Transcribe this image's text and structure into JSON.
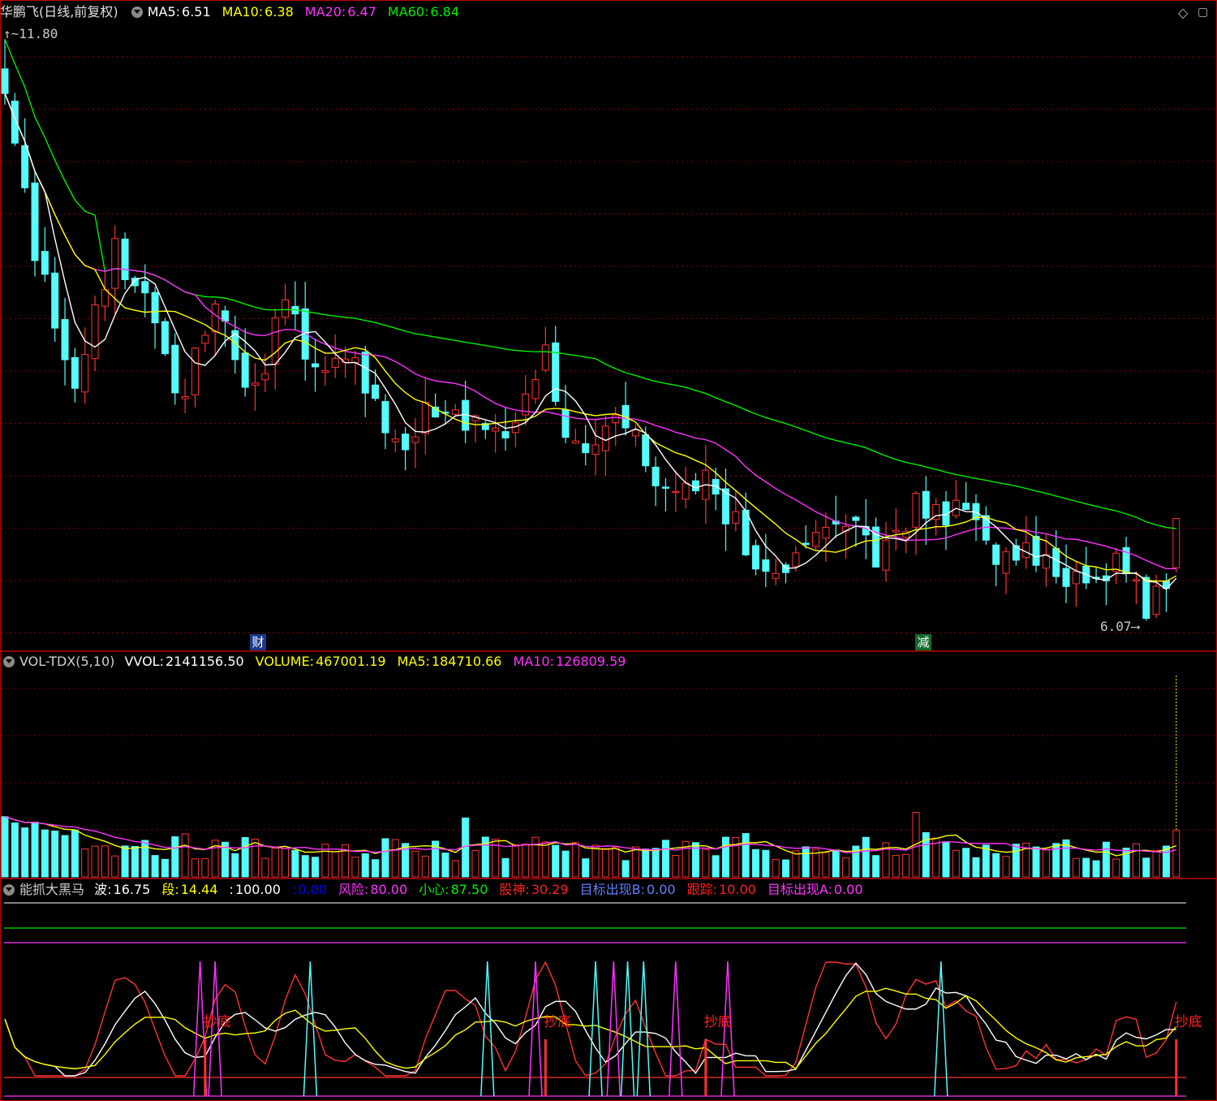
{
  "title": {
    "stock": "华鹏飞",
    "period": "(日线,前复权)"
  },
  "header_main": [
    {
      "label": "MA5:",
      "value": "6.51",
      "color": "#ffffff"
    },
    {
      "label": "MA10:",
      "value": "6.38",
      "color": "#ffff00"
    },
    {
      "label": "MA20:",
      "value": "6.47",
      "color": "#ff33ff"
    },
    {
      "label": "MA60:",
      "value": "6.84",
      "color": "#00ee00"
    }
  ],
  "header_vol": {
    "name": "VOL-TDX(5,10)",
    "items": [
      {
        "label": "VVOL:",
        "value": "2141156.50",
        "color": "#ffffff"
      },
      {
        "label": "VOLUME:",
        "value": "467001.19",
        "color": "#ffff00"
      },
      {
        "label": "MA5:",
        "value": "184710.66",
        "color": "#ffff00"
      },
      {
        "label": "MA10:",
        "value": "126809.59",
        "color": "#ff33ff"
      }
    ]
  },
  "header_ind": {
    "name": "能抓大黑马",
    "items": [
      {
        "label": "波:",
        "value": "16.75",
        "color": "#ffffff"
      },
      {
        "label": "段:",
        "value": "14.44",
        "color": "#ffff00"
      },
      {
        "label": ":",
        "value": "100.00",
        "color": "#ffffff"
      },
      {
        "label": ":",
        "value": "0.00",
        "color": "#0000ff"
      },
      {
        "label": "风险:",
        "value": "80.00",
        "color": "#ff33ff"
      },
      {
        "label": "小心:",
        "value": "87.50",
        "color": "#00ee00"
      },
      {
        "label": "股神:",
        "value": "30.29",
        "color": "#ff2020"
      },
      {
        "label": "目标出现B:",
        "value": "0.00",
        "color": "#6080ff"
      },
      {
        "label": "跟踪:",
        "value": "10.00",
        "color": "#ff2020"
      },
      {
        "label": "目标出现A:",
        "value": "0.00",
        "color": "#ff33ff"
      }
    ]
  },
  "annotations": {
    "high": "11.80",
    "low": "6.07",
    "tag_cai": "财",
    "tag_jian": "减",
    "buy_label": "抄底"
  },
  "colors": {
    "up": "#ff3333",
    "down": "#54fcfc",
    "grid": "#8b0000",
    "ma5": "#ffffff",
    "ma10": "#ffff00",
    "ma20": "#ff33ff",
    "ma60": "#00ee00"
  },
  "icons": [
    "diamond-icon",
    "maximize-icon"
  ],
  "chart_data": {
    "type": "candlestick",
    "price_range": [
      6.07,
      11.8
    ],
    "trend": [
      [
        0,
        11.3
      ],
      [
        3,
        9.6
      ],
      [
        7,
        8.2
      ],
      [
        11,
        9.7
      ],
      [
        14,
        9.2
      ],
      [
        17,
        8.1
      ],
      [
        21,
        9.0
      ],
      [
        25,
        8.2
      ],
      [
        28,
        9.2
      ],
      [
        31,
        8.4
      ],
      [
        35,
        8.6
      ],
      [
        39,
        7.6
      ],
      [
        42,
        8.1
      ],
      [
        46,
        8.0
      ],
      [
        50,
        7.7
      ],
      [
        54,
        8.6
      ],
      [
        57,
        7.6
      ],
      [
        62,
        7.9
      ],
      [
        66,
        7.25
      ],
      [
        70,
        7.3
      ],
      [
        75,
        6.6
      ],
      [
        79,
        6.5
      ],
      [
        84,
        6.9
      ],
      [
        87,
        6.6
      ],
      [
        91,
        7.1
      ],
      [
        95,
        7.0
      ],
      [
        99,
        6.6
      ],
      [
        104,
        6.5
      ],
      [
        108,
        6.3
      ],
      [
        111,
        6.45
      ],
      [
        114,
        6.07
      ],
      [
        117,
        6.4
      ]
    ],
    "bursts": [
      19.5,
      21,
      30.5,
      48.2,
      53,
      59,
      60.8,
      62.2,
      63.8,
      67,
      72.2,
      93.5
    ],
    "buy_points": [
      20,
      54,
      70,
      117
    ]
  }
}
